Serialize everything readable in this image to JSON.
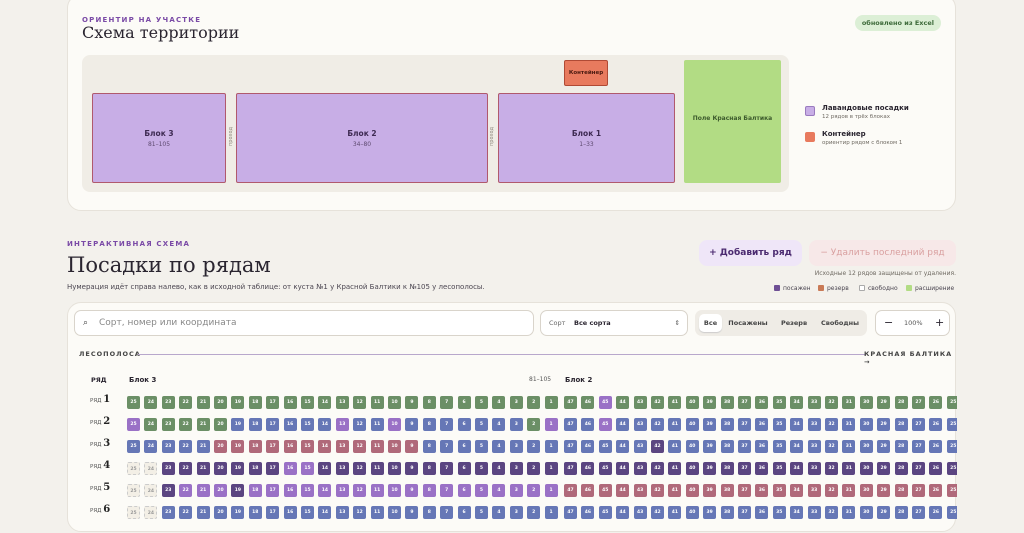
{
  "site": {
    "kicker": "ОРИЕНТИР НА УЧАСТКЕ",
    "title": "Схема территории",
    "excel_badge": "обновлено из Excel",
    "blocks": [
      {
        "name": "Блок 3",
        "range": "81–105"
      },
      {
        "name": "Блок 2",
        "range": "34–80"
      },
      {
        "name": "Блок 1",
        "range": "1–33"
      }
    ],
    "passage_label": "проход",
    "container_label": "Контейнер",
    "field_label": "Поле Красная Балтика",
    "legend": [
      {
        "title": "Лавандовые посадки",
        "sub": "12 рядов в трёх блоках",
        "color": "#c8aee6"
      },
      {
        "title": "Контейнер",
        "sub": "ориентир рядом с блоком 1",
        "color": "#e87a5e"
      }
    ]
  },
  "section": {
    "kicker": "ИНТЕРАКТИВНАЯ СХЕМА",
    "title": "Посадки по рядам",
    "subtitle": "Нумерация идёт справа налево, как в исходной таблице: от куста №1 у Красной Балтики к №105 у лесополосы.",
    "add_button": "+ Добавить ряд",
    "delete_button": "− Удалить последний ряд",
    "protect_note": "Исходные 12 рядов защищены от удаления.",
    "status_legend": [
      {
        "label": "посажен",
        "color": "#6e4f94"
      },
      {
        "label": "резерв",
        "color": "#c97a56"
      },
      {
        "label": "свободно",
        "color": "#ffffff"
      },
      {
        "label": "расширение",
        "color": "#b2dc84"
      }
    ]
  },
  "toolbar": {
    "search_icon": "⌕",
    "search_placeholder": "Сорт, номер или координата",
    "sort_label": "Сорт",
    "sort_value": "Все сорта",
    "filters": [
      "Все",
      "Посажены",
      "Резерв",
      "Свободны"
    ],
    "zoom_minus": "−",
    "zoom_value": "100%",
    "zoom_plus": "+"
  },
  "grid": {
    "left_label": "ЛЕСОПОЛОСА",
    "right_label": "КРАСНАЯ БАЛТИКА →",
    "row_header": "РЯД",
    "block3_label": "Блок 3",
    "block3_range": "81–105",
    "block2_label": "Блок 2",
    "row_prefix": "РЯД",
    "rows": [
      {
        "num": "1",
        "empty": 0,
        "b1": "GGGGGGGGGGGGGGGGGGGGGGGGG",
        "b2": "GGPGGGGGGGGGGGGGGGGGGGGGG"
      },
      {
        "num": "2",
        "empty": 0,
        "b1": "PGGGGGBBBBBBPBBPBBBBBBBGP",
        "b2": "BBPBBBBBBBBBBBBBBBBBBBBBB"
      },
      {
        "num": "3",
        "empty": 0,
        "b1": "BBBBBRRRRRRRRRRRRBBBBBBBB",
        "b2": "BBBBBDBBBBBBBBBBBBBBBBBBB"
      },
      {
        "num": "4",
        "empty": 2,
        "b1": "DDDDDDDDDPPDDDDDDDDDDDDDD",
        "b2": "DDDDDDDDDDDDDDDDDDDDDDDDD"
      },
      {
        "num": "5",
        "empty": 2,
        "b1": "DDDPPPDPPPPPPPPPPPPPPPPPP",
        "b2": "RRRRRRRRRRRRRRRRRRRRRRRRR"
      },
      {
        "num": "6",
        "empty": 2,
        "b1": "BBBBBBBBBBBBBBBBBBBBBBBBB",
        "b2": "BBBBBBBBBBBBBBBBBBBBBBBBB"
      }
    ]
  },
  "palette": {
    "G": "#6b8f66",
    "P": "#9a71c6",
    "B": "#6677b6",
    "R": "#b0697a",
    "D": "#5b4581"
  }
}
